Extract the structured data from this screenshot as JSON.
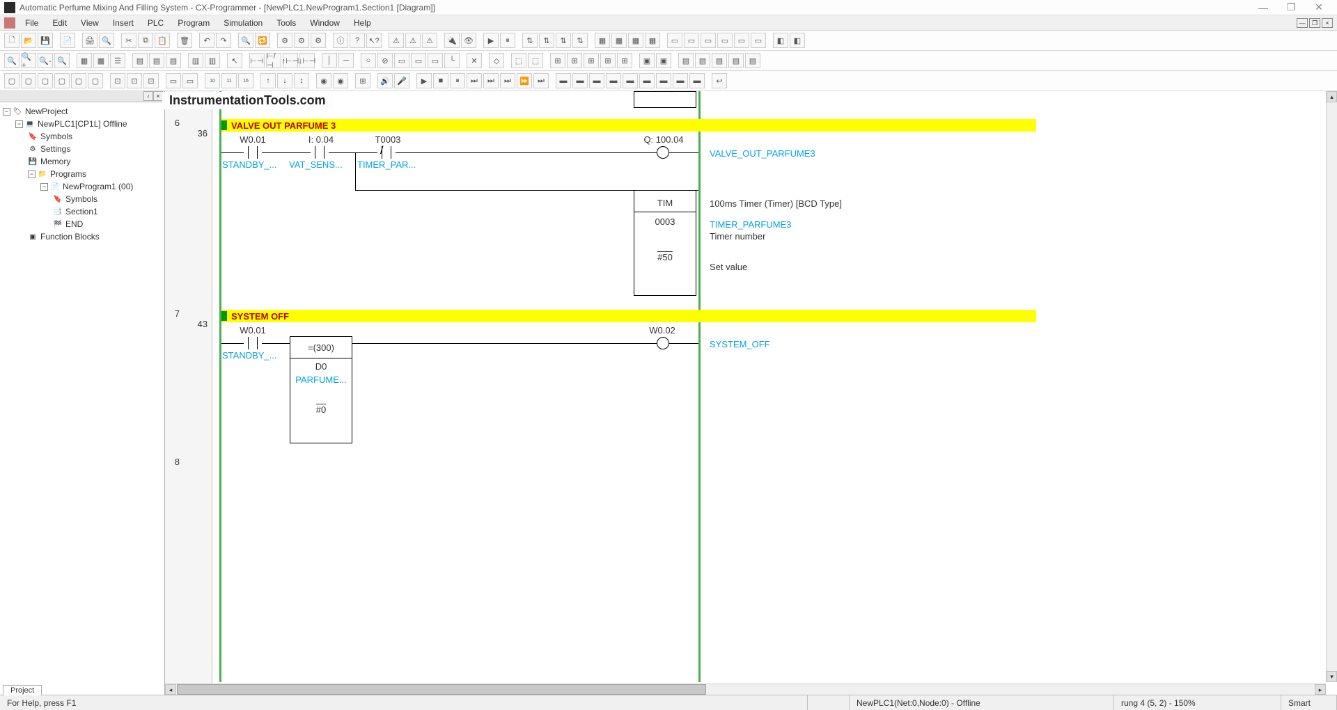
{
  "title": "Automatic Perfume Mixing And Filling System - CX-Programmer - [NewPLC1.NewProgram1.Section1 [Diagram]]",
  "menu": {
    "file": "File",
    "edit": "Edit",
    "view": "View",
    "insert": "Insert",
    "plc": "PLC",
    "program": "Program",
    "simulation": "Simulation",
    "tools": "Tools",
    "window": "Window",
    "help": "Help"
  },
  "watermark": "InstrumentationTools.com",
  "tree": {
    "root": "NewProject",
    "plc": "NewPLC1[CP1L] Offline",
    "symbols": "Symbols",
    "settings": "Settings",
    "memory": "Memory",
    "programs": "Programs",
    "newprogram": "NewProgram1 (00)",
    "symbols2": "Symbols",
    "section1": "Section1",
    "end": "END",
    "fb": "Function Blocks",
    "tab": "Project"
  },
  "diagram": {
    "rung6_num": "6",
    "rung6_sub": "36",
    "rung7_num": "7",
    "rung7_sub": "43",
    "rung8_num": "8",
    "rung6_title": "VALVE OUT PARFUME 3",
    "rung7_title": "SYSTEM OFF",
    "r6_c1_addr": "W0.01",
    "r6_c1_lbl": "STANDBY_...",
    "r6_c2_addr": "I: 0.04",
    "r6_c2_lbl": "VAT_SENS...",
    "r6_c3_addr": "T0003",
    "r6_c3_lbl": "TIMER_PAR...",
    "r6_out_addr": "Q: 100.04",
    "r6_out_lbl": "VALVE_OUT_PARFUME3",
    "r6_tim": "TIM",
    "r6_tim_num": "0003",
    "r6_tim_val": "#50",
    "r6_tim_desc": "100ms Timer (Timer) [BCD Type]",
    "r6_tim_lbl": "TIMER_PARFUME3",
    "r6_tim_sub1": "Timer number",
    "r6_tim_sub2": "Set value",
    "r7_c1_addr": "W0.01",
    "r7_c1_lbl": "STANDBY_...",
    "r7_cmp_op": "=(300)",
    "r7_cmp_d": "D0",
    "r7_cmp_lbl": "PARFUME...",
    "r7_cmp_val": "#0",
    "r7_out_addr": "W0.02",
    "r7_out_lbl": "SYSTEM_OFF"
  },
  "status": {
    "help": "For Help, press F1",
    "plc": "NewPLC1(Net:0,Node:0) - Offline",
    "rung": "rung 4 (5, 2)  - 150%",
    "smart": "Smart"
  }
}
